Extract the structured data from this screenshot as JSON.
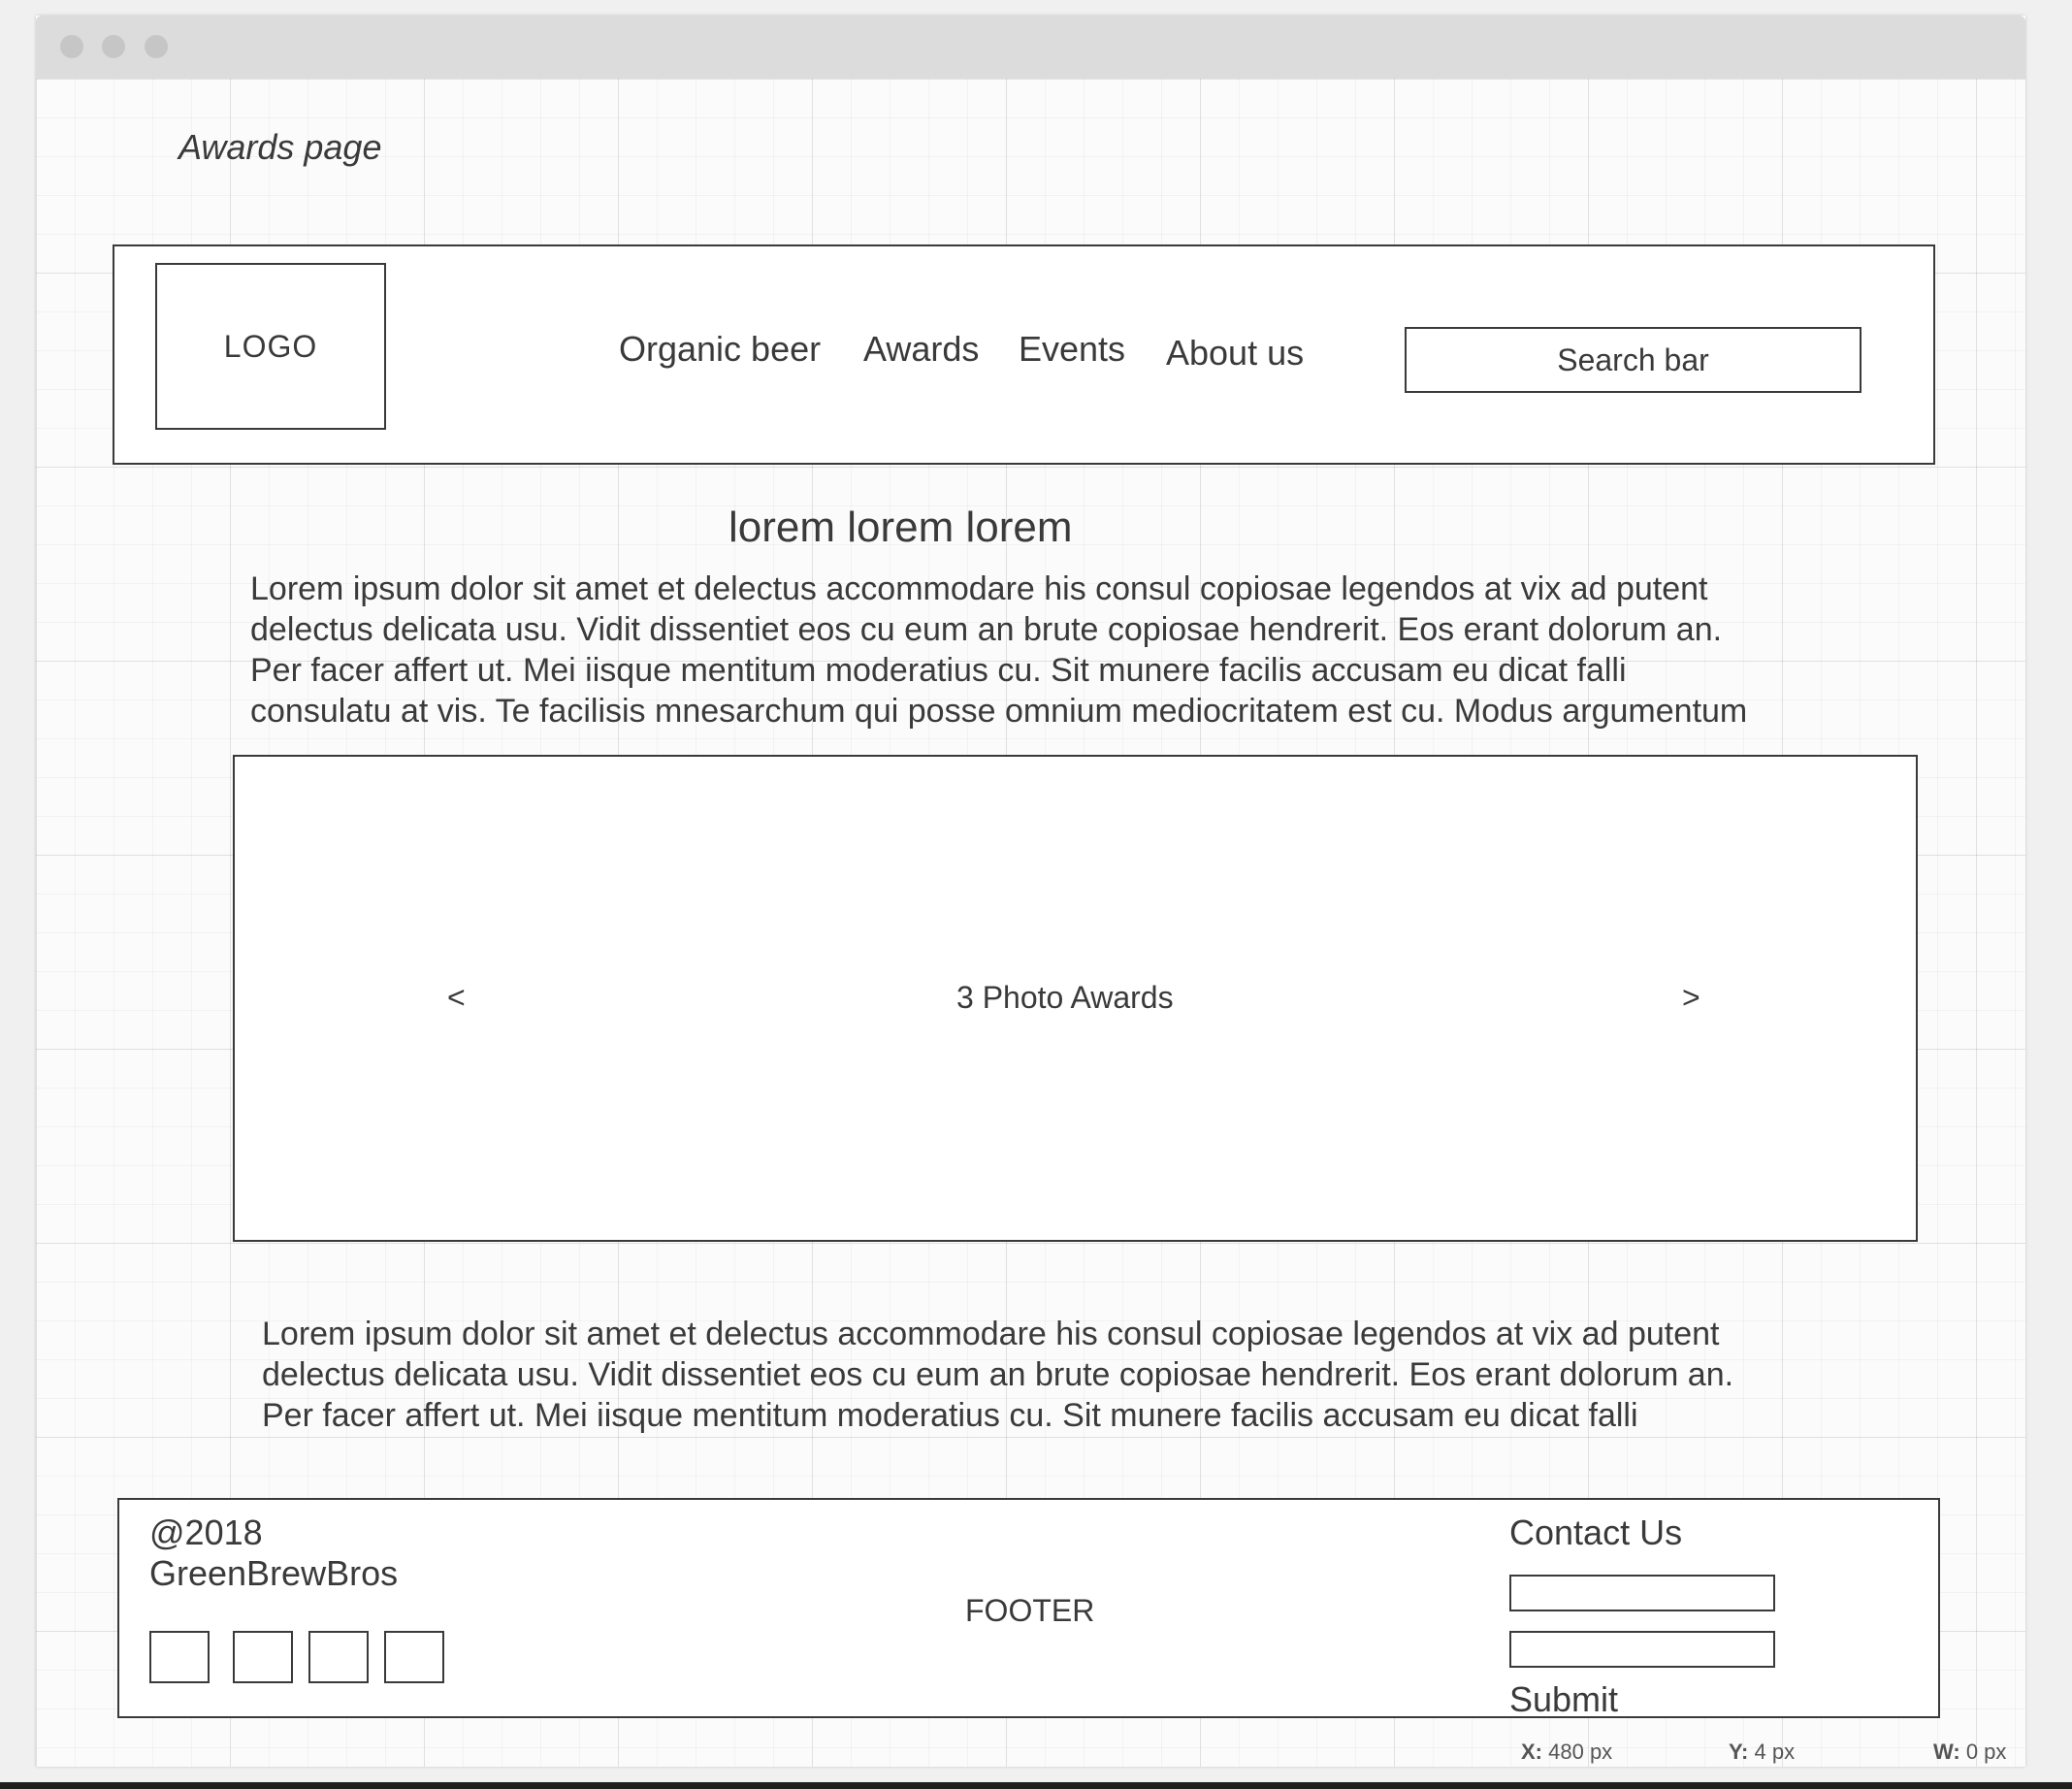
{
  "page_label": "Awards page",
  "header": {
    "logo": "LOGO",
    "nav": [
      "Organic beer",
      "Awards",
      "Events",
      "About us"
    ],
    "search": "Search bar"
  },
  "main": {
    "heading": "lorem lorem lorem",
    "paragraph1": [
      "Lorem ipsum dolor sit amet et delectus accommodare his consul copiosae legendos at vix ad putent",
      "delectus delicata usu. Vidit dissentiet eos cu eum an brute copiosae hendrerit. Eos erant dolorum an.",
      "Per facer affert ut. Mei iisque mentitum moderatius cu. Sit munere facilis accusam eu dicat falli",
      "consulatu at vis. Te facilisis mnesarchum qui posse omnium mediocritatem est cu. Modus argumentum"
    ],
    "carousel": {
      "prev": "<",
      "label": "3 Photo Awards",
      "next": ">"
    },
    "paragraph2": [
      "Lorem ipsum dolor sit amet et delectus accommodare his consul copiosae legendos at vix ad putent",
      "delectus delicata usu. Vidit dissentiet eos cu eum an brute copiosae hendrerit. Eos erant dolorum an.",
      "Per facer affert ut. Mei iisque mentitum moderatius cu. Sit munere facilis accusam eu dicat falli"
    ]
  },
  "footer": {
    "copyright_year": "@2018",
    "copyright_name": "GreenBrewBros",
    "label": "FOOTER",
    "contact_title": "Contact Us",
    "submit": "Submit"
  },
  "status_bar": {
    "x_label": "X:",
    "x_value": "480 px",
    "y_label": "Y:",
    "y_value": "4 px",
    "w_label": "W:",
    "w_value": "0 px"
  },
  "colors": {
    "ink": "#3a3a3a",
    "titlebar": "#dcdcdc",
    "canvas": "#fbfbfb"
  }
}
